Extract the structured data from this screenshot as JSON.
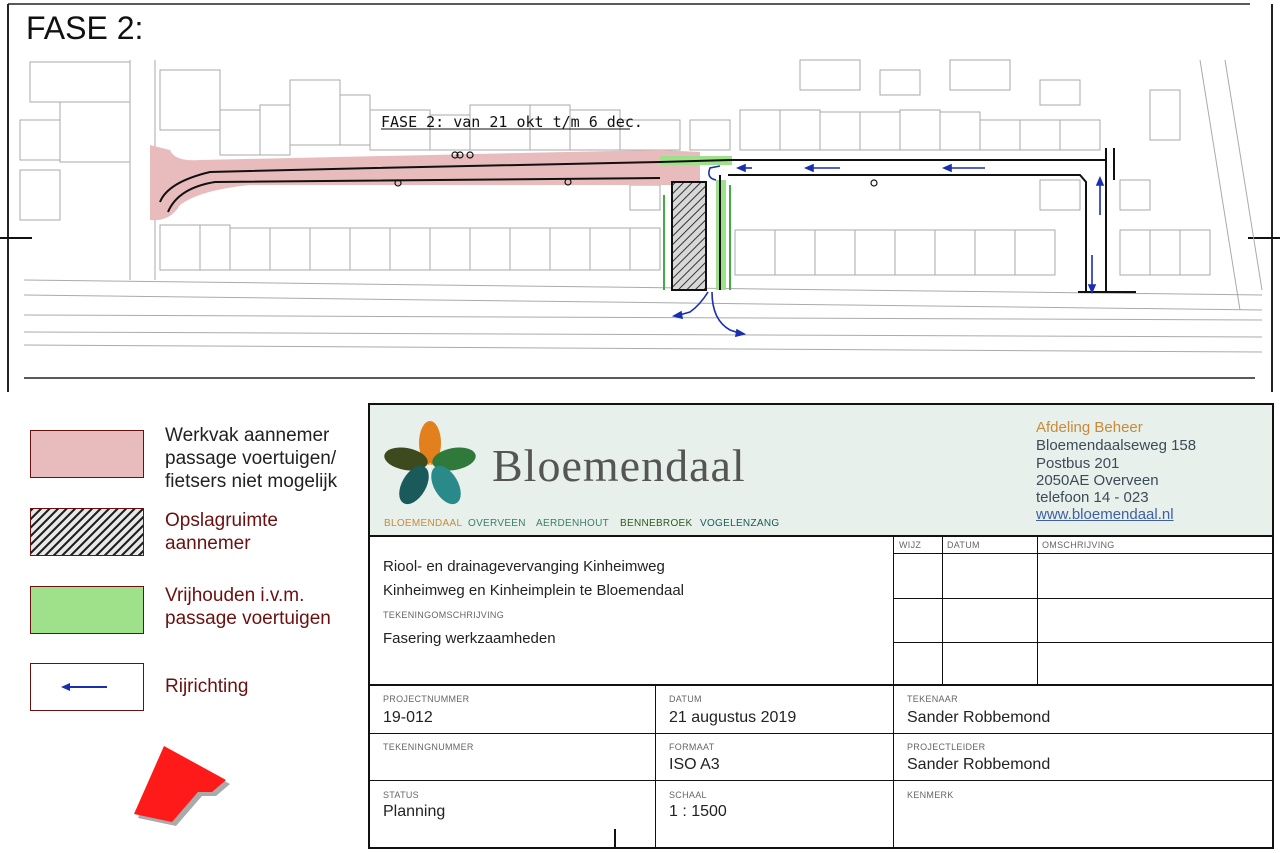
{
  "map": {
    "phase_title": "FASE 2:",
    "phase_label": "FASE 2: van 21 okt t/m 6 dec."
  },
  "legend": {
    "items": [
      {
        "label": "Werkvak aannemer\npassage voertuigen/\nfietsers niet mogelijk",
        "color": "#e8bcbc"
      },
      {
        "label": "Opslagruimte\naannemer",
        "color": "#333333"
      },
      {
        "label": "Vrijhouden i.v.m.\npassage voertuigen",
        "color": "#9fe08a"
      },
      {
        "label": "Rijrichting",
        "color": "#1a2fb0"
      }
    ]
  },
  "title_block": {
    "brand": "Bloemendaal",
    "regions": [
      "BLOEMENDAAL",
      "OVERVEEN",
      "AERDENHOUT",
      "BENNEBROEK",
      "VOGELENZANG"
    ],
    "department": "Afdeling Beheer",
    "address": [
      "Bloemendaalseweg 158",
      "Postbus 201",
      "2050AE Overveen",
      "telefoon 14 - 023"
    ],
    "url": "www.bloemendaal.nl",
    "project_line1": "Riool- en drainagevervanging Kinheimweg",
    "project_line2": "Kinheimweg en Kinheimplein te Bloemendaal",
    "drawing_desc_label": "TEKENINGOMSCHRIJVING",
    "drawing_desc": "Fasering werkzaamheden",
    "revision_headers": [
      "WIJZ",
      "DATUM",
      "OMSCHRIJVING"
    ],
    "fields": {
      "projectnummer": {
        "label": "PROJECTNUMMER",
        "value": "19-012"
      },
      "datum": {
        "label": "DATUM",
        "value": "21 augustus 2019"
      },
      "tekenaar": {
        "label": "TEKENAAR",
        "value": "Sander Robbemond"
      },
      "tekeningnummer": {
        "label": "TEKENINGNUMMER",
        "value": ""
      },
      "formaat": {
        "label": "FORMAAT",
        "value": "ISO A3"
      },
      "projectleider": {
        "label": "PROJECTLEIDER",
        "value": "Sander Robbemond"
      },
      "status": {
        "label": "STATUS",
        "value": "Planning"
      },
      "schaal": {
        "label": "SCHAAL",
        "value": "1 : 1500"
      },
      "kenmerk": {
        "label": "KENMERK",
        "value": ""
      }
    }
  },
  "colors": {
    "work_area": "#e8bcbc",
    "keep_free": "#9fe08a",
    "direction_arrow": "#1a2fb0",
    "north_arrow": "#ff1a1a"
  }
}
